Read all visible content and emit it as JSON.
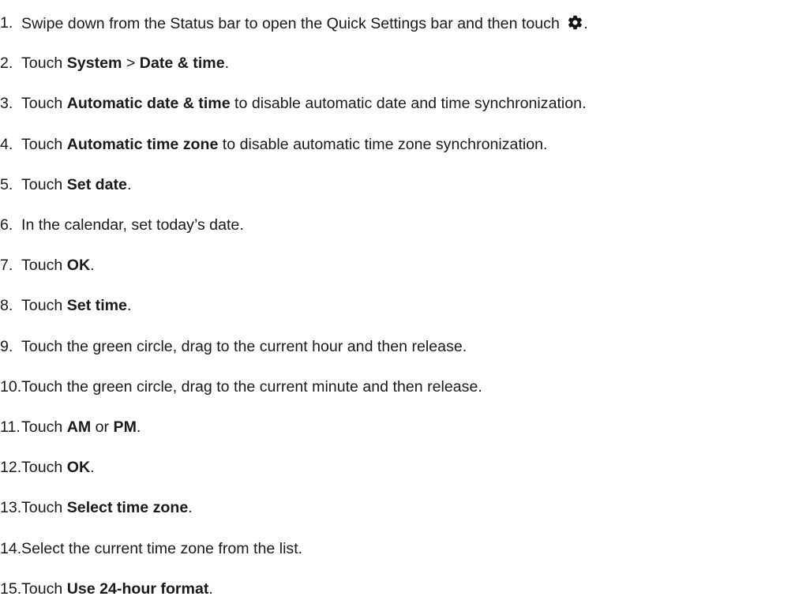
{
  "steps": [
    {
      "num": "1.",
      "parts": [
        {
          "t": "Swipe down from the Status bar to open the Quick Settings bar and then touch ",
          "b": false
        },
        {
          "icon": "gear-icon"
        },
        {
          "t": ".",
          "b": false
        }
      ]
    },
    {
      "num": "2.",
      "parts": [
        {
          "t": "Touch ",
          "b": false
        },
        {
          "t": "System",
          "b": true
        },
        {
          "t": " > ",
          "b": false
        },
        {
          "t": "Date & time",
          "b": true
        },
        {
          "t": ".",
          "b": false
        }
      ]
    },
    {
      "num": "3.",
      "parts": [
        {
          "t": "Touch ",
          "b": false
        },
        {
          "t": "Automatic date & time",
          "b": true
        },
        {
          "t": " to disable automatic date and time synchronization.",
          "b": false
        }
      ]
    },
    {
      "num": "4.",
      "parts": [
        {
          "t": "Touch ",
          "b": false
        },
        {
          "t": "Automatic time zone",
          "b": true
        },
        {
          "t": " to disable automatic time zone synchronization.",
          "b": false
        }
      ]
    },
    {
      "num": "5.",
      "parts": [
        {
          "t": "Touch ",
          "b": false
        },
        {
          "t": "Set date",
          "b": true
        },
        {
          "t": ".",
          "b": false
        }
      ]
    },
    {
      "num": "6.",
      "parts": [
        {
          "t": "In the calendar, set today’s date.",
          "b": false
        }
      ]
    },
    {
      "num": "7.",
      "parts": [
        {
          "t": "Touch ",
          "b": false
        },
        {
          "t": "OK",
          "b": true
        },
        {
          "t": ".",
          "b": false
        }
      ]
    },
    {
      "num": "8.",
      "parts": [
        {
          "t": "Touch ",
          "b": false
        },
        {
          "t": "Set time",
          "b": true
        },
        {
          "t": ".",
          "b": false
        }
      ]
    },
    {
      "num": "9.",
      "parts": [
        {
          "t": "Touch the green circle, drag to the current hour and then release.",
          "b": false
        }
      ]
    },
    {
      "num": "10.",
      "parts": [
        {
          "t": "Touch the green circle, drag to the current minute and then release.",
          "b": false
        }
      ]
    },
    {
      "num": "11.",
      "parts": [
        {
          "t": "Touch ",
          "b": false
        },
        {
          "t": "AM",
          "b": true
        },
        {
          "t": " or ",
          "b": false
        },
        {
          "t": "PM",
          "b": true
        },
        {
          "t": ".",
          "b": false
        }
      ]
    },
    {
      "num": "12.",
      "parts": [
        {
          "t": "Touch ",
          "b": false
        },
        {
          "t": "OK",
          "b": true
        },
        {
          "t": ".",
          "b": false
        }
      ]
    },
    {
      "num": "13.",
      "parts": [
        {
          "t": "Touch ",
          "b": false
        },
        {
          "t": "Select time zone",
          "b": true
        },
        {
          "t": ".",
          "b": false
        }
      ]
    },
    {
      "num": "14.",
      "parts": [
        {
          "t": "Select the current time zone from the list.",
          "b": false
        }
      ]
    },
    {
      "num": "15.",
      "parts": [
        {
          "t": "Touch ",
          "b": false
        },
        {
          "t": "Use 24-hour format",
          "b": true
        },
        {
          "t": ".",
          "b": false
        }
      ]
    }
  ]
}
